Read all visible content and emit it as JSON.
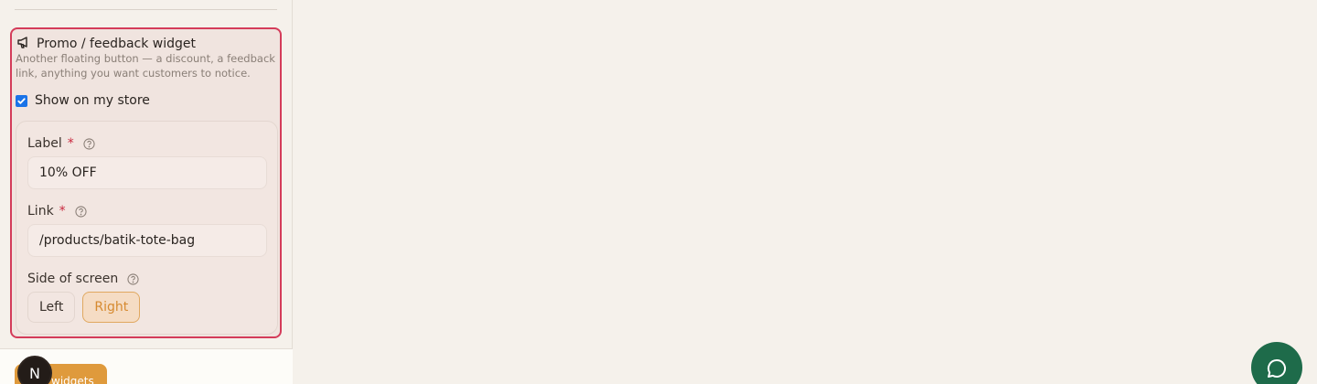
{
  "widget": {
    "title": "Promo / feedback widget",
    "description": "Another floating button — a discount, a feedback link, anything you want customers to notice.",
    "icon": "megaphone-icon",
    "show_label": "Show on my store",
    "show_checked": true,
    "fields": {
      "label": {
        "label": "Label",
        "required_mark": "*",
        "value": "10% OFF"
      },
      "link": {
        "label": "Link",
        "required_mark": "*",
        "value": "/products/batik-tote-bag"
      }
    },
    "side": {
      "label": "Side of screen",
      "options": [
        "Left",
        "Right"
      ],
      "selected": "Right"
    }
  },
  "footer": {
    "save_label": "widgets",
    "avatar_initial": "N"
  },
  "colors": {
    "accent": "#df9a3c",
    "highlight_border": "#d43c5a",
    "chat": "#1e6b4a"
  }
}
